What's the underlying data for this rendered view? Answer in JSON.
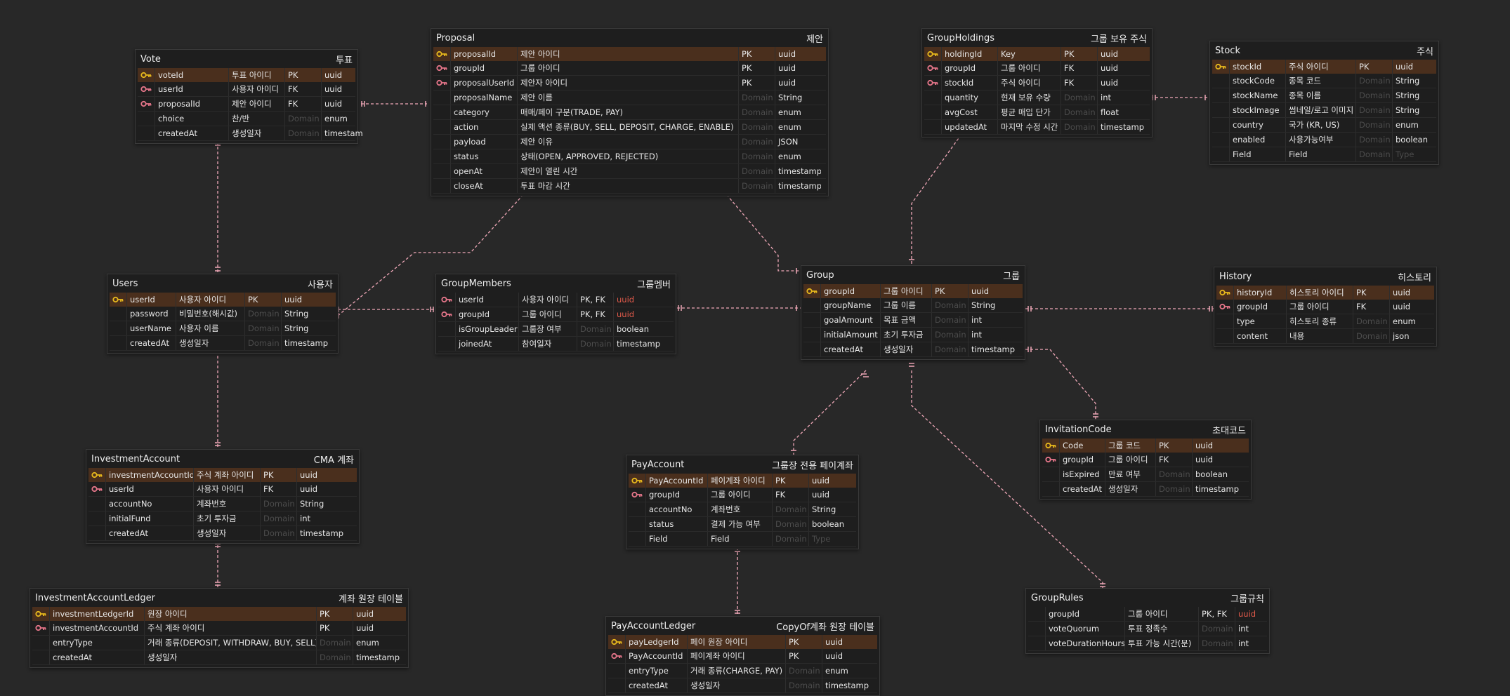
{
  "colors": {
    "background": "#282828",
    "edge": "#f0a8b8",
    "pk_row": "#4a2f1d",
    "pk_key": "#e8b91d",
    "fk_key": "#e6768a",
    "type_error": "#e05a4a"
  },
  "entities": [
    {
      "id": "vote",
      "name": "Vote",
      "comment": "투표",
      "cols": [
        105,
        80,
        52,
        58
      ],
      "fields": [
        {
          "name": "voteId",
          "comment": "투표 아이디",
          "key": "PK",
          "type": "uuid",
          "icon": "pk-key",
          "pk": true
        },
        {
          "name": "userId",
          "comment": "사용자 아이디",
          "key": "FK",
          "type": "uuid",
          "icon": "fk-key"
        },
        {
          "name": "proposalId",
          "comment": "제안 아이디",
          "key": "FK",
          "type": "uuid",
          "icon": "fk-key"
        },
        {
          "name": "choice",
          "comment": "찬/반",
          "key": "Domain",
          "type": "enum"
        },
        {
          "name": "createdAt",
          "comment": "생성일자",
          "key": "Domain",
          "type": "timestamp"
        }
      ]
    },
    {
      "id": "proposal",
      "name": "Proposal",
      "comment": "제안",
      "cols": [
        95,
        315,
        52,
        65
      ],
      "fields": [
        {
          "name": "proposalId",
          "comment": "제안 아이디",
          "key": "PK",
          "type": "uuid",
          "icon": "pk-key",
          "pk": true
        },
        {
          "name": "groupId",
          "comment": "그룹 아이디",
          "key": "PK",
          "type": "uuid",
          "icon": "fk-key"
        },
        {
          "name": "proposalUserId",
          "comment": "제안자 아이디",
          "key": "PK",
          "type": "uuid",
          "icon": "fk-key"
        },
        {
          "name": "proposalName",
          "comment": "제안 이름",
          "key": "Domain",
          "type": "String"
        },
        {
          "name": "category",
          "comment": "매매/페이 구분(TRADE, PAY)",
          "key": "Domain",
          "type": "enum"
        },
        {
          "name": "action",
          "comment": "실제 액션 종류(BUY, SELL, DEPOSIT, CHARGE, ENABLE)",
          "key": "Domain",
          "type": "enum"
        },
        {
          "name": "payload",
          "comment": "제안 이유",
          "key": "Domain",
          "type": "JSON"
        },
        {
          "name": "status",
          "comment": "상태(OPEN, APPROVED, REJECTED)",
          "key": "Domain",
          "type": "enum"
        },
        {
          "name": "openAt",
          "comment": "제안이 열린 시간",
          "key": "Domain",
          "type": "timestamp"
        },
        {
          "name": "closeAt",
          "comment": "투표 마감 시간",
          "key": "Domain",
          "type": "timestamp"
        }
      ]
    },
    {
      "id": "groupholdings",
      "name": "GroupHoldings",
      "comment": "그룹 보유 주식",
      "cols": [
        80,
        90,
        52,
        80
      ],
      "fields": [
        {
          "name": "holdingId",
          "comment": "Key",
          "key": "PK",
          "type": "uuid",
          "icon": "pk-key",
          "pk": true
        },
        {
          "name": "groupId",
          "comment": "그룹 아이디",
          "key": "FK",
          "type": "uuid",
          "icon": "fk-key"
        },
        {
          "name": "stockId",
          "comment": "주식 아이디",
          "key": "FK",
          "type": "uuid",
          "icon": "fk-key"
        },
        {
          "name": "quantity",
          "comment": "현재 보유 수량",
          "key": "Domain",
          "type": "int"
        },
        {
          "name": "avgCost",
          "comment": "평균 매입 단가",
          "key": "Domain",
          "type": "float"
        },
        {
          "name": "updatedAt",
          "comment": "마지막 수정 시간",
          "key": "Domain",
          "type": "timestamp"
        }
      ]
    },
    {
      "id": "stock",
      "name": "Stock",
      "comment": "주식",
      "cols": [
        80,
        100,
        52,
        60
      ],
      "fields": [
        {
          "name": "stockId",
          "comment": "주식 아이디",
          "key": "PK",
          "type": "uuid",
          "icon": "pk-key",
          "pk": true
        },
        {
          "name": "stockCode",
          "comment": "종목 코드",
          "key": "Domain",
          "type": "String"
        },
        {
          "name": "stockName",
          "comment": "종목 이름",
          "key": "Domain",
          "type": "String"
        },
        {
          "name": "stockImage",
          "comment": "썸네일/로고 이미지",
          "key": "Domain",
          "type": "String"
        },
        {
          "name": "country",
          "comment": "국가 (KR, US)",
          "key": "Domain",
          "type": "enum"
        },
        {
          "name": "enabled",
          "comment": "사용가능여부",
          "key": "Domain",
          "type": "boolean"
        },
        {
          "name": "Field",
          "comment": "Field",
          "key": "Domain",
          "type": "Type"
        }
      ]
    },
    {
      "id": "users",
      "name": "Users",
      "comment": "사용자",
      "cols": [
        70,
        98,
        52,
        74
      ],
      "fields": [
        {
          "name": "userId",
          "comment": "사용자 아이디",
          "key": "PK",
          "type": "uuid",
          "icon": "pk-key",
          "pk": true
        },
        {
          "name": "password",
          "comment": "비밀번호(해시값)",
          "key": "Domain",
          "type": "String"
        },
        {
          "name": "userName",
          "comment": "사용자 이름",
          "key": "Domain",
          "type": "String"
        },
        {
          "name": "createdAt",
          "comment": "생성일자",
          "key": "Domain",
          "type": "timestamp"
        }
      ]
    },
    {
      "id": "groupmembers",
      "name": "GroupMembers",
      "comment": "그룹멤버",
      "cols": [
        90,
        83,
        52,
        78
      ],
      "fields": [
        {
          "name": "userId",
          "comment": "사용자 아이디",
          "key": "PK, FK",
          "type": "uuid",
          "icon": "fk-key",
          "red": true
        },
        {
          "name": "groupId",
          "comment": "그룹 아이디",
          "key": "PK, FK",
          "type": "uuid",
          "icon": "fk-key",
          "red": true
        },
        {
          "name": "isGroupLeader",
          "comment": "그룹장 여부",
          "key": "Domain",
          "type": "boolean"
        },
        {
          "name": "joinedAt",
          "comment": "참여일자",
          "key": "Domain",
          "type": "timestamp"
        }
      ]
    },
    {
      "id": "group",
      "name": "Group",
      "comment": "그룹",
      "cols": [
        85,
        73,
        52,
        78
      ],
      "fields": [
        {
          "name": "groupId",
          "comment": "그룹 아이디",
          "key": "PK",
          "type": "uuid",
          "icon": "pk-key",
          "pk": true
        },
        {
          "name": "groupName",
          "comment": "그룹 이름",
          "key": "Domain",
          "type": "String"
        },
        {
          "name": "goalAmount",
          "comment": "목표 금액",
          "key": "Domain",
          "type": "int"
        },
        {
          "name": "initialAmount",
          "comment": "초기 투자금",
          "key": "Domain",
          "type": "int"
        },
        {
          "name": "createdAt",
          "comment": "생성일자",
          "key": "Domain",
          "type": "timestamp"
        }
      ]
    },
    {
      "id": "history",
      "name": "History",
      "comment": "히스토리",
      "cols": [
        75,
        95,
        52,
        58
      ],
      "fields": [
        {
          "name": "historyId",
          "comment": "히스토리 아이디",
          "key": "PK",
          "type": "uuid",
          "icon": "pk-key",
          "pk": true
        },
        {
          "name": "groupId",
          "comment": "그룹 아이디",
          "key": "FK",
          "type": "uuid",
          "icon": "fk-key"
        },
        {
          "name": "type",
          "comment": "히스토리 종류",
          "key": "Domain",
          "type": "enum"
        },
        {
          "name": "content",
          "comment": "내용",
          "key": "Domain",
          "type": "json"
        }
      ]
    },
    {
      "id": "investmentaccount",
      "name": "InvestmentAccount",
      "comment": "CMA 계좌",
      "cols": [
        125,
        95,
        52,
        80
      ],
      "fields": [
        {
          "name": "investmentAccountId",
          "comment": "주식 계좌 아이디",
          "key": "PK",
          "type": "uuid",
          "icon": "pk-key",
          "pk": true
        },
        {
          "name": "userId",
          "comment": "사용자 아이디",
          "key": "FK",
          "type": "uuid",
          "icon": "fk-key"
        },
        {
          "name": "accountNo",
          "comment": "계좌번호",
          "key": "Domain",
          "type": "String"
        },
        {
          "name": "initialFund",
          "comment": "초기 투자금",
          "key": "Domain",
          "type": "int"
        },
        {
          "name": "createdAt",
          "comment": "생성일자",
          "key": "Domain",
          "type": "timestamp"
        }
      ]
    },
    {
      "id": "payaccount",
      "name": "PayAccount",
      "comment": "그룹장 전용 페이계좌",
      "cols": [
        88,
        92,
        52,
        58
      ],
      "fields": [
        {
          "name": "PayAccountId",
          "comment": "페이계좌 아이디",
          "key": "PK",
          "type": "uuid",
          "icon": "pk-key",
          "pk": true
        },
        {
          "name": "groupId",
          "comment": "그룹 아이디",
          "key": "FK",
          "type": "uuid",
          "icon": "fk-key"
        },
        {
          "name": "accountNo",
          "comment": "계좌번호",
          "key": "Domain",
          "type": "String"
        },
        {
          "name": "status",
          "comment": "결제 가능 여부",
          "key": "Domain",
          "type": "boolean"
        },
        {
          "name": "Field",
          "comment": "Field",
          "key": "Domain",
          "type": "Type"
        }
      ]
    },
    {
      "id": "invitationcode",
      "name": "InvitationCode",
      "comment": "초대코드",
      "cols": [
        65,
        72,
        52,
        72
      ],
      "fields": [
        {
          "name": "Code",
          "comment": "그룹 코드",
          "key": "PK",
          "type": "uuid",
          "icon": "pk-key",
          "pk": true
        },
        {
          "name": "groupId",
          "comment": "그룹 아이디",
          "key": "FK",
          "type": "uuid",
          "icon": "fk-key"
        },
        {
          "name": "isExpired",
          "comment": "만료 여부",
          "key": "Domain",
          "type": "boolean"
        },
        {
          "name": "createdAt",
          "comment": "생성일자",
          "key": "Domain",
          "type": "timestamp"
        }
      ]
    },
    {
      "id": "investmentaccountledger",
      "name": "InvestmentAccountLedger",
      "comment": "계좌 원장 테이블",
      "cols": [
        135,
        245,
        52,
        70
      ],
      "fields": [
        {
          "name": "investmentLedgerId",
          "comment": "원장 아이디",
          "key": "PK",
          "type": "uuid",
          "icon": "pk-key",
          "pk": true
        },
        {
          "name": "investmentAccountId",
          "comment": "주식 계좌 아이디",
          "key": "PK",
          "type": "uuid",
          "icon": "fk-key"
        },
        {
          "name": "entryType",
          "comment": "거래 종류(DEPOSIT, WITHDRAW, BUY, SELL)",
          "key": "Domain",
          "type": "enum"
        },
        {
          "name": "createdAt",
          "comment": "생성일자",
          "key": "Domain",
          "type": "timestamp"
        }
      ]
    },
    {
      "id": "payaccountledger",
      "name": "PayAccountLedger",
      "comment": "CopyOf계좌 원장 테이블",
      "cols": [
        88,
        140,
        52,
        68
      ],
      "fields": [
        {
          "name": "payLedgerId",
          "comment": "페이 원장 아이디",
          "key": "PK",
          "type": "uuid",
          "icon": "pk-key",
          "pk": true
        },
        {
          "name": "PayAccountId",
          "comment": "페이계좌 아이디",
          "key": "PK",
          "type": "uuid",
          "icon": "fk-key"
        },
        {
          "name": "entryType",
          "comment": "거래 종류(CHARGE, PAY)",
          "key": "Domain",
          "type": "enum"
        },
        {
          "name": "createdAt",
          "comment": "생성일자",
          "key": "Domain",
          "type": "timestamp"
        }
      ]
    },
    {
      "id": "grouprules",
      "name": "GroupRules",
      "comment": "그룹규칙",
      "cols": [
        113,
        105,
        52,
        42
      ],
      "fields": [
        {
          "name": "groupId",
          "comment": "그룹 아이디",
          "key": "PK, FK",
          "type": "uuid",
          "icon": "none",
          "red": true
        },
        {
          "name": "voteQuorum",
          "comment": "투표 정족수",
          "key": "Domain",
          "type": "int"
        },
        {
          "name": "voteDurationHours",
          "comment": "투표 가능 시간(분)",
          "key": "Domain",
          "type": "int"
        }
      ]
    }
  ]
}
